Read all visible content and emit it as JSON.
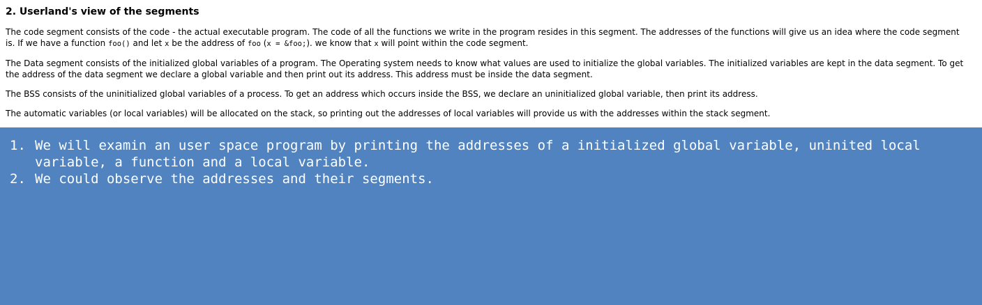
{
  "document": {
    "heading": "2. Userland's view of the segments",
    "para1": {
      "t1": "The code segment consists of the code - the actual executable program. The code of all the functions we write in the program resides in this segment. The addresses of the functions will give us an idea where the code segment is. If we have a function ",
      "c1": "foo()",
      "t2": " and let ",
      "c2": "x",
      "t3": " be the address of ",
      "c3": "foo",
      "t4": " (",
      "c4": "x = &foo;",
      "t5": "). we know that ",
      "c5": "x",
      "t6": " will point within the code segment."
    },
    "para2": "The Data segment consists of the initialized global variables of a program. The Operating system needs to know what values are used to initialize the global variables. The initialized variables are kept in the data segment. To get the address of the data segment we declare a global variable and then print out its address. This address must be inside the data segment.",
    "para3": "The BSS consists of the uninitialized global variables of a process. To get an address which occurs inside the BSS, we declare an uninitialized global variable, then print its address.",
    "para4": "The automatic variables (or local variables) will be allocated on the stack, so printing out the addresses of local variables will provide us with the addresses within the stack segment."
  },
  "notes": {
    "items": [
      {
        "number": "1.",
        "text": "We will examin an user space program by printing the addresses of a initialized global variable, uninited local variable, a function and a local variable."
      },
      {
        "number": "2.",
        "text": "We could observe the addresses and their segments."
      }
    ]
  },
  "colors": {
    "panel_background": "#5083bf",
    "panel_text": "#ffffff"
  }
}
